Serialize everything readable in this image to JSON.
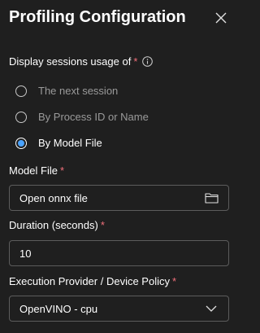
{
  "panel": {
    "title": "Profiling Configuration",
    "close_icon": "close-icon"
  },
  "sessions": {
    "label": "Display sessions usage of",
    "required_mark": "*",
    "info_icon": "info-icon",
    "options": [
      {
        "label": "The next session",
        "selected": false,
        "enabled": false
      },
      {
        "label": "By Process ID or Name",
        "selected": false,
        "enabled": false
      },
      {
        "label": "By Model File",
        "selected": true,
        "enabled": true
      }
    ]
  },
  "model_file": {
    "label": "Model File",
    "required_mark": "*",
    "value": "Open onnx file",
    "icon": "folder-icon"
  },
  "duration": {
    "label": "Duration (seconds)",
    "required_mark": "*",
    "value": "10"
  },
  "execution_provider": {
    "label": "Execution Provider / Device Policy",
    "required_mark": "*",
    "value": "OpenVINO - cpu",
    "icon": "chevron-down-icon"
  },
  "colors": {
    "background": "#1f1f1f",
    "required": "#f1707b",
    "radio_accent": "#4aa3ff",
    "border": "#5c5c5c"
  }
}
